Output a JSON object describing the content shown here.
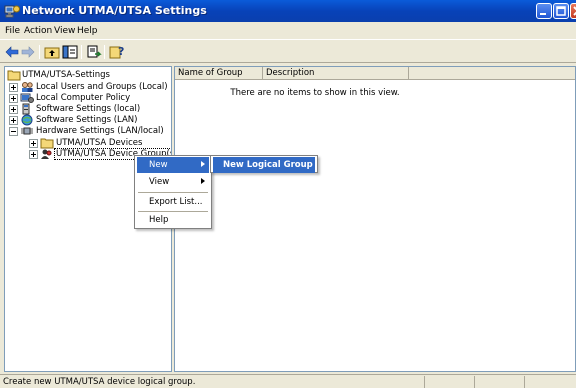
{
  "window": {
    "title": "Network UTMA/UTSA Settings",
    "title_icon": "network-settings-icon",
    "controls": [
      "minimize-icon",
      "maximize-icon",
      "close-icon"
    ]
  },
  "menubar": {
    "items": [
      "File",
      "Action",
      "View",
      "Help"
    ]
  },
  "toolbar": {
    "buttons": [
      "back-arrow-icon",
      "forward-arrow-icon",
      "up-folder-icon",
      "show-hide-tree-icon",
      "export-list-icon",
      "help-icon"
    ]
  },
  "tree": {
    "root": "UTMA/UTSA-Settings",
    "items": [
      {
        "label": "Local Users and Groups (Local)",
        "icon": "users-icon",
        "expander": "plus"
      },
      {
        "label": "Local Computer Policy",
        "icon": "policy-icon",
        "expander": "plus"
      },
      {
        "label": "Software Settings (local)",
        "icon": "software-icon",
        "expander": "plus"
      },
      {
        "label": "Software Settings (LAN)",
        "icon": "software-lan-icon",
        "expander": "plus"
      },
      {
        "label": "Hardware Settings (LAN/local)",
        "icon": "hardware-icon",
        "expander": "minus"
      },
      {
        "label": "UTMA/UTSA Devices",
        "icon": "folder-icon",
        "expander": "plus"
      },
      {
        "label": "UTMA/UTSA Device Group(s)",
        "icon": "device-group-icon",
        "expander": "plus"
      }
    ]
  },
  "list": {
    "columns": [
      "Name of Group",
      "Description"
    ],
    "empty_message": "There are no items to show in this view."
  },
  "context_menu": {
    "items": [
      {
        "label": "New",
        "has_submenu": true,
        "highlighted": true
      },
      {
        "label": "View",
        "has_submenu": true,
        "highlighted": false
      },
      {
        "label": "Export List...",
        "has_submenu": false,
        "highlighted": false
      },
      {
        "label": "Help",
        "has_submenu": false,
        "highlighted": false
      }
    ]
  },
  "submenu": {
    "items": [
      {
        "label": "New Logical Group",
        "highlighted": true
      }
    ]
  },
  "status_bar": {
    "text": "Create  new UTMA/UTSA device logical group."
  },
  "colors": {
    "titlebar": "#0842b8",
    "menu_highlight": "#316ac5",
    "chrome": "#ece9d8"
  }
}
